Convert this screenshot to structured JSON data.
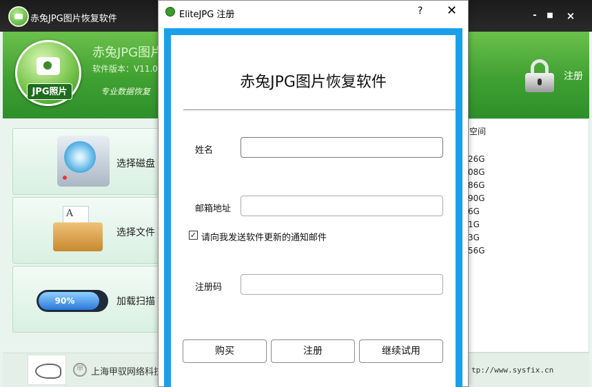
{
  "app": {
    "title": "赤兔JPG图片恢复软件",
    "header_title": "赤兔JPG图片",
    "version": "软件版本：V11.0",
    "slogan": "专业数据恢复",
    "logo_label": "JPG照片",
    "register_label": "注册"
  },
  "window_controls": {
    "minimize": "-",
    "maximize": "■",
    "close": "×"
  },
  "sidebar": {
    "items": [
      {
        "label": "选择磁盘",
        "icon": "disk-icon"
      },
      {
        "label": "选择文件",
        "icon": "folder-icon"
      },
      {
        "label": "加载扫描",
        "icon": "progress-icon",
        "progress_text": "90%",
        "progress": 0.9
      }
    ]
  },
  "right_panel": {
    "header": "空间",
    "rows": [
      "26G",
      "08G",
      "86G",
      "90G",
      "6G",
      "1G",
      "3G",
      "56G"
    ]
  },
  "footer": {
    "company": "上海甲驭网络科技",
    "url": "tp://www.sysfix.cn"
  },
  "dialog": {
    "title": "EliteJPG 注册",
    "help": "?",
    "close": "✕",
    "heading": "赤兔JPG图片恢复软件",
    "name_label": "姓名",
    "name_value": "",
    "email_label": "邮箱地址",
    "email_value": "",
    "checkbox_label": "请向我发送软件更新的通知邮件",
    "checkbox_checked": true,
    "code_label": "注册码",
    "code_value": "",
    "buttons": {
      "buy": "购买",
      "register": "注册",
      "trial": "继续试用"
    }
  },
  "colors": {
    "accent": "#1aa0ea",
    "header_green": "#3fa032"
  }
}
